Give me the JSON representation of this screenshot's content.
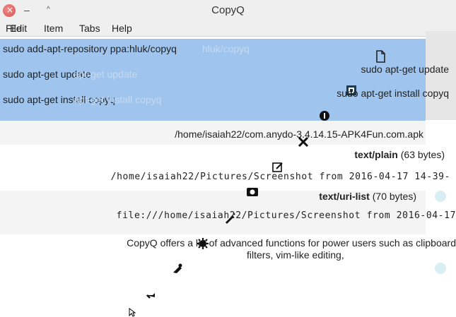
{
  "window": {
    "title": "CopyQ",
    "close_glyph": "×",
    "minimize_glyph": "–",
    "maximize_glyph": "^"
  },
  "menu": {
    "items": [
      "File",
      "Edit",
      "Item",
      "Tabs",
      "Help"
    ]
  },
  "items": [
    {
      "left": "sudo add-apt-repository ppa:hluk/copyq",
      "ghost": "hluk/copyq",
      "right_icon": "document-icon",
      "right": ""
    },
    {
      "left": "sudo apt-get update",
      "ghost": "apt-get update",
      "right_icon": "copy-icon",
      "right": "sudo apt-get update"
    },
    {
      "left": "sudo apt-get install copyq",
      "ghost": "apt-get install copyq",
      "right_icon": "pin-icon",
      "right": "sudo apt-get install copyq"
    },
    {
      "left": "/home/isaiah22/com.anydo-3.4.14.15-APK4Fun.com.apk",
      "right_icon": "info-icon",
      "right": "/home/isaiah22/com.anydo-3.4.14.15-APK4Fun.com.apk"
    },
    {
      "left": "",
      "right_icon": "tool-icon",
      "right_bold": "text/plain",
      "right": " (63 bytes)"
    },
    {
      "left": "/home/isaiah22/Pictures/Screenshot from 2016-04-17 14-39-",
      "right_icon": "edit-icon",
      "right": "/home/isaiah22/Pictures/Screenshot from 2016-04-17 14-39-"
    },
    {
      "left": "",
      "right_icon": "image-icon",
      "right_bold": "text/uri-list",
      "right": " (70 bytes)"
    },
    {
      "left": "file:///home/isaiah22/Pictures/Screenshot from 2016-04-17",
      "right_icon": "pencil-icon",
      "right": "file:///home/isaiah22/Pictures/Screenshot from 2016-04-17"
    },
    {
      "left": "CopyQ offers a lot of advanced functions for power users such as clipboard",
      "right_icon": "gear-icon",
      "right": "filters, vim-like editing,"
    },
    {
      "left": "",
      "right_icon": "hand-icon",
      "right": ""
    },
    {
      "left": "",
      "right_icon": "hand-icon",
      "right": ""
    }
  ],
  "visible_text": {
    "row1_left": "sudo add-apt-repository ppa:hluk/copyq",
    "row1_ghost": "hluk/copyq",
    "row2_left": "sudo apt-get update",
    "row2_ghost": "apt-get update",
    "row2_right": "sudo apt-get update",
    "row3_left": "sudo apt-get install copyq",
    "row3_ghost": "apt-get install copyq",
    "row3_right": "sudo apt-get install copyq",
    "row4_right": "/home/isaiah22/com.anydo-3.4.14.15-APK4Fun.com.apk",
    "row5_bold": "text/plain",
    "row5_rest": " (63 bytes)",
    "row6_right": "/home/isaiah22/Pictures/Screenshot from 2016-04-17 14-39-",
    "row7_bold": "text/uri-list",
    "row7_rest": " (70 bytes)",
    "row8_right": "file:///home/isaiah22/Pictures/Screenshot from 2016-04-17",
    "row9_line1": "CopyQ offers a lot of advanced functions for power users such as clipboard",
    "row9_line2": "filters, vim-like editing,"
  },
  "colors": {
    "selection": "#9fc5ee",
    "titlebar": "#efefef",
    "close_button": "#d9534f"
  }
}
